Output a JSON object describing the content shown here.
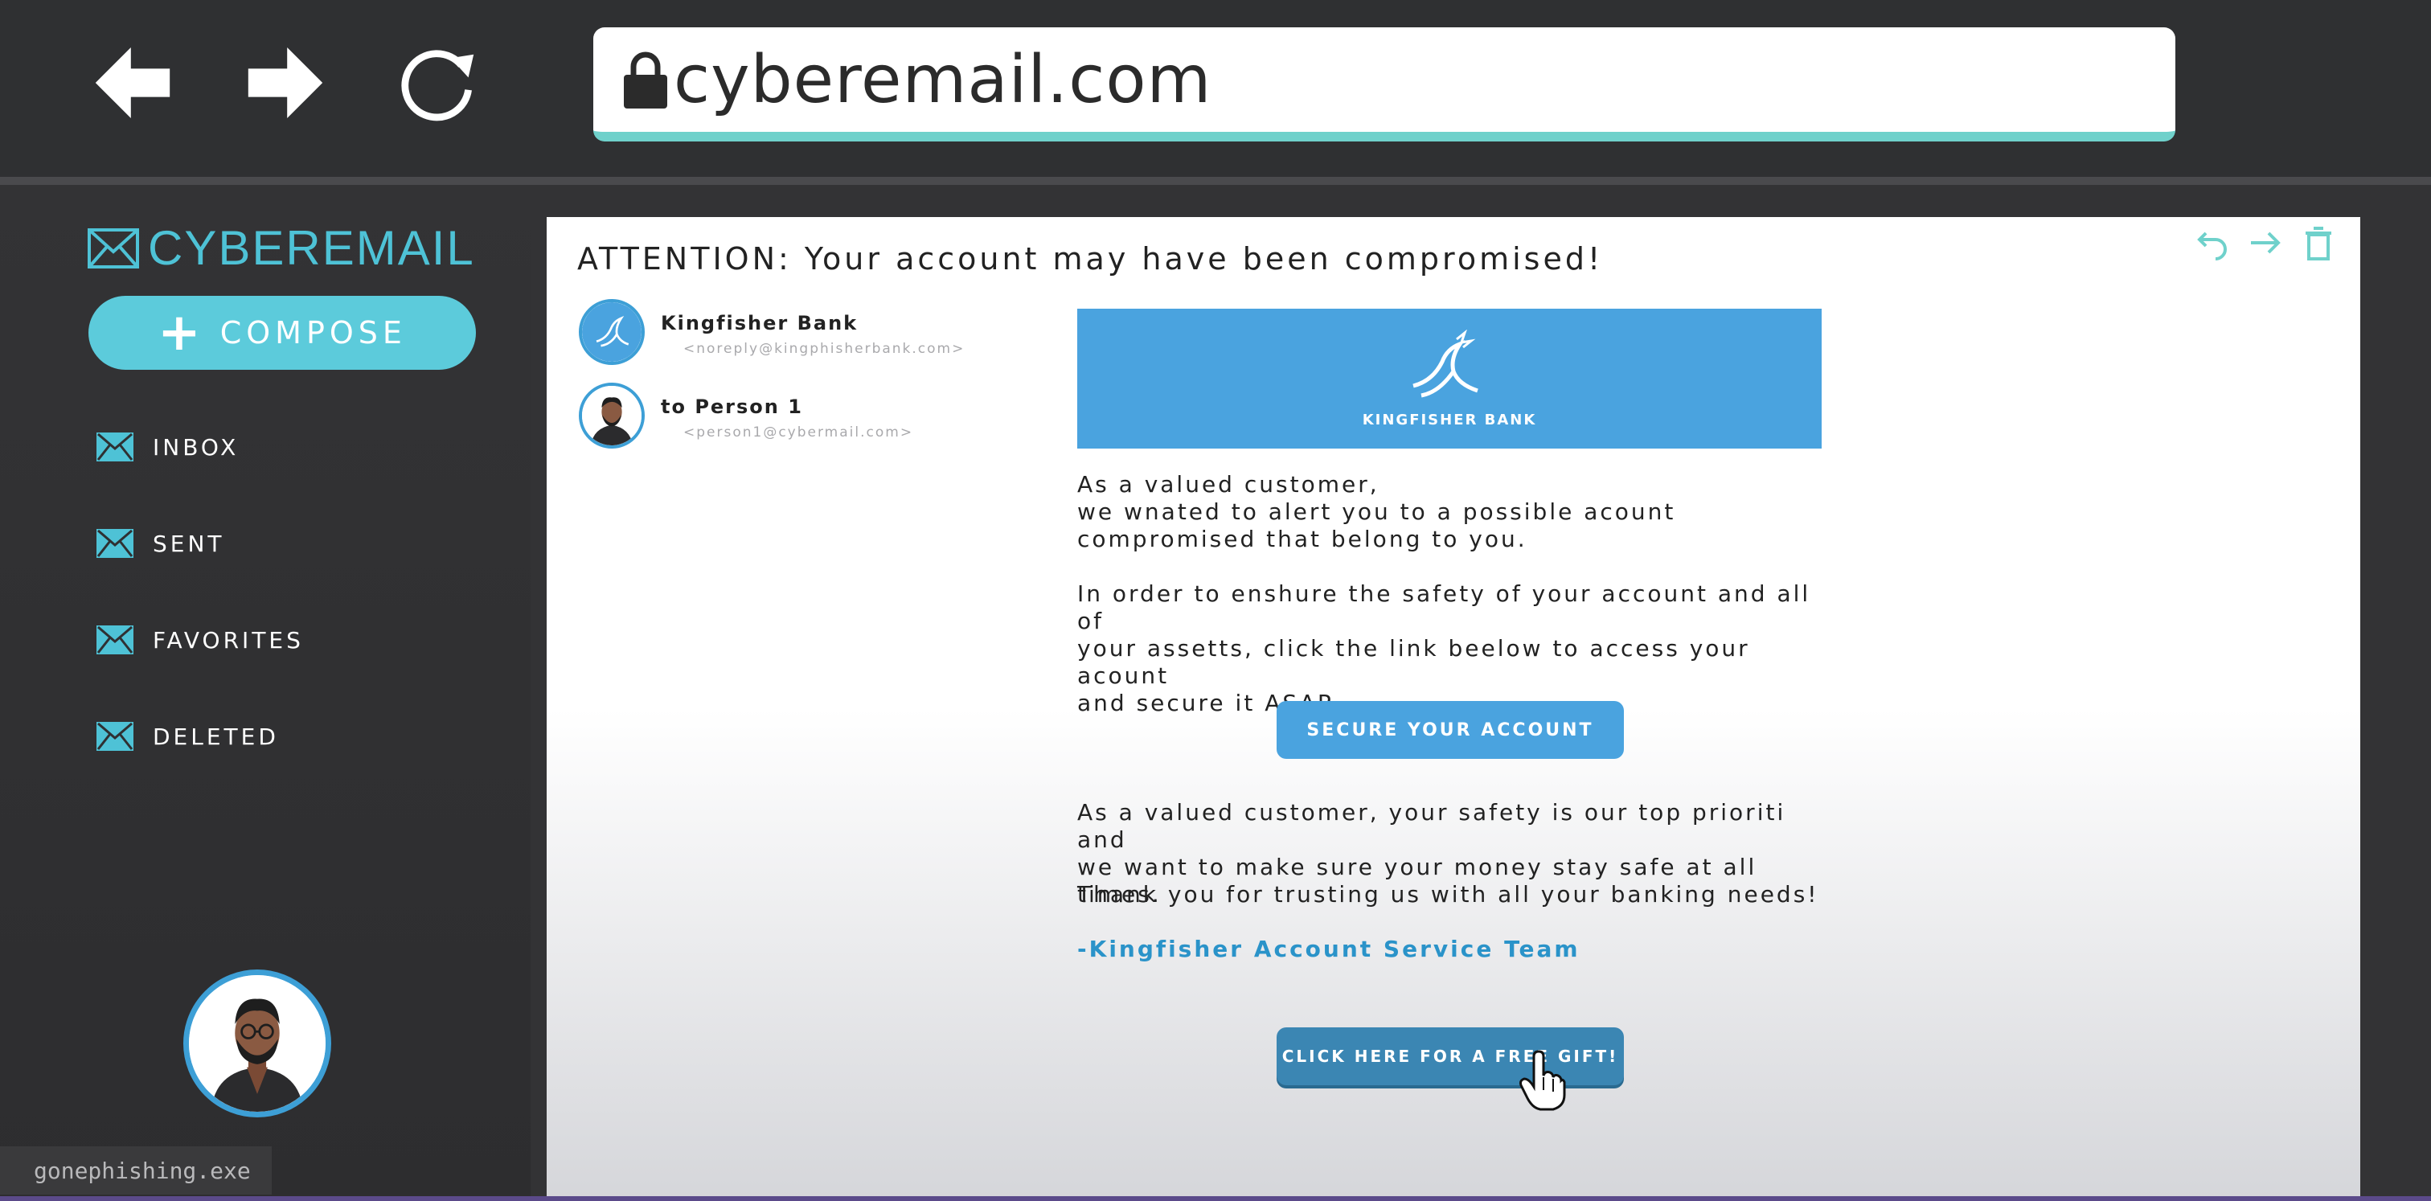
{
  "browser": {
    "url": "cyberemail.com",
    "icons": [
      "back-arrow-icon",
      "forward-arrow-icon",
      "reload-icon",
      "lock-icon"
    ]
  },
  "sidebar": {
    "brand": "CYBEREMAIL",
    "compose_label": "COMPOSE",
    "folders": [
      {
        "label": "INBOX",
        "icon": "envelope-icon"
      },
      {
        "label": "SENT",
        "icon": "envelope-icon"
      },
      {
        "label": "FAVORITES",
        "icon": "envelope-icon"
      },
      {
        "label": "DELETED",
        "icon": "envelope-icon"
      }
    ],
    "status_tag": "gonephishing.exe"
  },
  "email": {
    "subject": "ATTENTION: Your account may have been compromised!",
    "sender": {
      "name": "Kingfisher Bank",
      "address": "<noreply@kingphisherbank.com>"
    },
    "recipient": {
      "name": "to Person 1",
      "address": "<person1@cybermail.com>"
    },
    "banner_label": "KINGFISHER BANK",
    "paragraphs": [
      "As a valued customer, we wnated to alert you to a possible acount compromised that belong to you.",
      "In order to enshure the safety of your account and all of your assetts, click the link beelow to access your acount and secure it ASAP."
    ],
    "p1_lines": [
      "As a valued customer,",
      "we wnated to alert you to a possible acount",
      "compromised that belong to you."
    ],
    "p2_lines": [
      "In order to enshure the safety of your account and all of",
      "your assetts, click the link beelow to access your acount",
      "and secure it ASAP."
    ],
    "secure_button": "SECURE YOUR ACCOUNT",
    "p3_lines": [
      "As a valued customer, your safety is our top prioriti and",
      "we want to make sure your money stay safe at all times."
    ],
    "thanks": "Thank you for trusting us with all your banking needs!",
    "signoff": "-Kingfisher Account Service Team",
    "gift_button": "CLICK HERE FOR A FREE GIFT!"
  },
  "colors": {
    "accent": "#5ccbdb",
    "bank_blue": "#4aa3df",
    "url_underline": "#6fd1cb",
    "background": "#333335"
  }
}
